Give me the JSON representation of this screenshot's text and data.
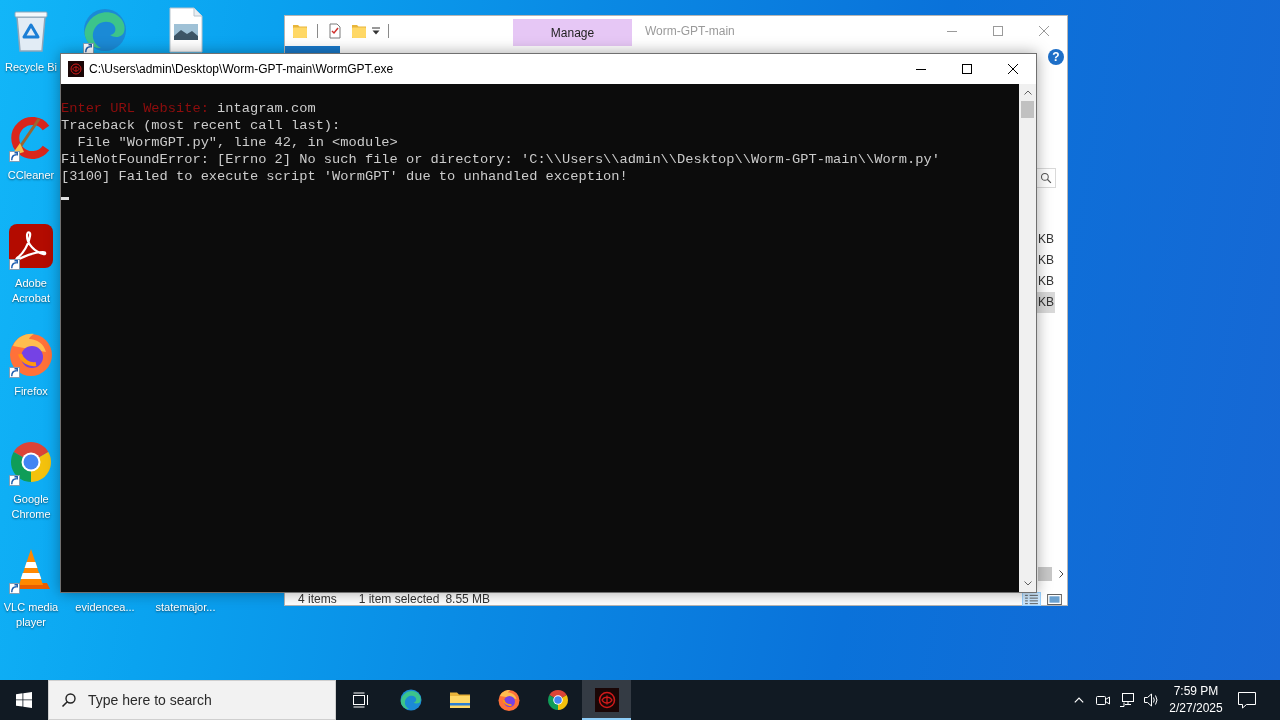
{
  "desktop": {
    "icons": [
      {
        "label": "Recycle Bi",
        "kind": "recycle"
      },
      {
        "label": "CCleaner",
        "kind": "ccleaner",
        "shortcut": true
      },
      {
        "label": "Adobe Acrobat",
        "kind": "acrobat",
        "shortcut": true
      },
      {
        "label": "Firefox",
        "kind": "firefox",
        "shortcut": true
      },
      {
        "label": "Google Chrome",
        "kind": "chrome",
        "shortcut": true
      },
      {
        "label": "VLC media player",
        "kind": "vlc",
        "shortcut": true
      },
      {
        "kind": "edge",
        "shortcut": true
      },
      {
        "label": "evidencea..."
      },
      {
        "kind": "image"
      },
      {
        "label": "statemajor..."
      }
    ]
  },
  "explorer": {
    "title": "Worm-GPT-main",
    "context_tab": "Manage",
    "help": "?",
    "rows": [
      {
        "size": "KB",
        "selected": false
      },
      {
        "size": "KB",
        "selected": false
      },
      {
        "size": "KB",
        "selected": false
      },
      {
        "size": "KB",
        "selected": true
      }
    ],
    "status_bar": {
      "item_count": "4 items",
      "selection": "1 item selected",
      "selection_size": "8.55 MB",
      "views": [
        {
          "kind": "details",
          "selected": true
        },
        {
          "kind": "thumbnails",
          "selected": false
        }
      ]
    }
  },
  "console": {
    "title": "C:\\Users\\admin\\Desktop\\Worm-GPT-main\\WormGPT.exe",
    "prompt": "Enter URL Website:",
    "input": "intagram.com",
    "lines": [
      "Traceback (most recent call last):",
      "  File \"WormGPT.py\", line 42, in <module>",
      "FileNotFoundError: [Errno 2] No such file or directory: 'C:\\\\Users\\\\admin\\\\Desktop\\\\Worm-GPT-main\\\\Worm.py'",
      "[3100] Failed to execute script 'WormGPT' due to unhandled exception!"
    ],
    "cursor": true
  },
  "taskbar": {
    "search": {
      "placeholder": "Type here to search"
    },
    "apps": [
      {
        "kind": "edge",
        "selected": false
      },
      {
        "kind": "folder",
        "selected": false
      },
      {
        "kind": "firefox",
        "selected": false
      },
      {
        "kind": "chrome",
        "selected": false
      },
      {
        "kind": "wormgpt",
        "selected": true
      }
    ],
    "clock": {
      "time": "7:59 PM",
      "date": "2/27/2025"
    }
  }
}
